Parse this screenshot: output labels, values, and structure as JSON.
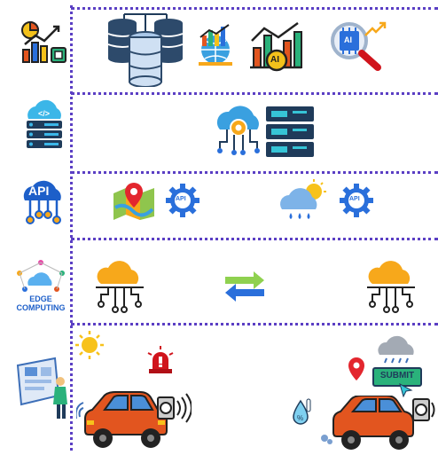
{
  "layers": {
    "api_badge": "API",
    "edge_line1": "EDGE",
    "edge_line2": "COMPUTING"
  },
  "icons": {
    "ai_chart_badge": "AI",
    "ai_chip_badge": "AI",
    "api_gear_left": "API",
    "api_gear_right": "API"
  },
  "scenario": {
    "submit_label": "SUBMIT"
  },
  "colors": {
    "separator": "#5b3fc4",
    "cloud_orange": "#f7a81b",
    "car_orange": "#e2551f",
    "gear_blue": "#2a6fdb",
    "server_dark": "#1f3b5a"
  }
}
